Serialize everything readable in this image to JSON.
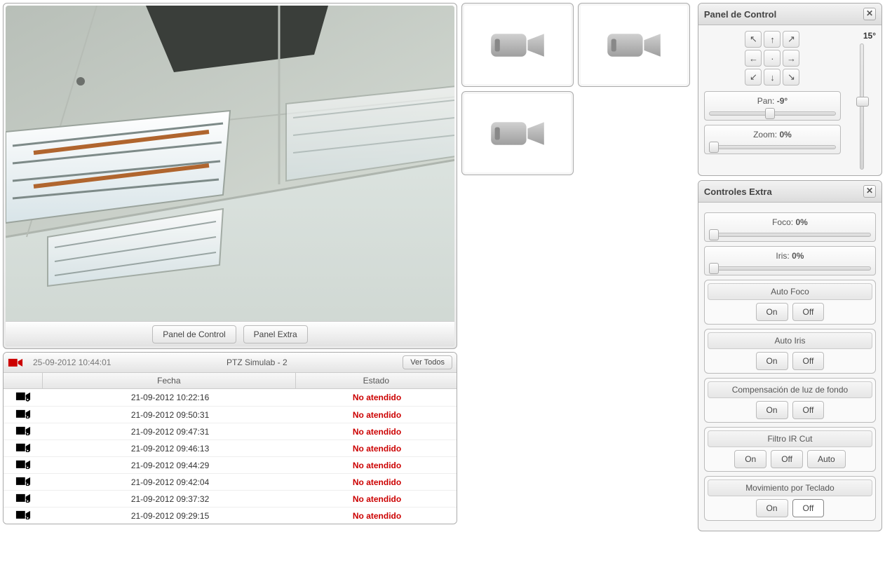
{
  "video": {
    "panel_control_btn": "Panel de Control",
    "panel_extra_btn": "Panel Extra"
  },
  "events": {
    "header_timestamp": "25-09-2012 10:44:01",
    "header_title": "PTZ Simulab - 2",
    "ver_todos_btn": "Ver Todos",
    "columns": {
      "fecha": "Fecha",
      "estado": "Estado"
    },
    "rows": [
      {
        "fecha": "21-09-2012 10:22:16",
        "estado": "No atendido"
      },
      {
        "fecha": "21-09-2012 09:50:31",
        "estado": "No atendido"
      },
      {
        "fecha": "21-09-2012 09:47:31",
        "estado": "No atendido"
      },
      {
        "fecha": "21-09-2012 09:46:13",
        "estado": "No atendido"
      },
      {
        "fecha": "21-09-2012 09:44:29",
        "estado": "No atendido"
      },
      {
        "fecha": "21-09-2012 09:42:04",
        "estado": "No atendido"
      },
      {
        "fecha": "21-09-2012 09:37:32",
        "estado": "No atendido"
      },
      {
        "fecha": "21-09-2012 09:29:15",
        "estado": "No atendido"
      }
    ]
  },
  "thumbnails": {
    "count": 3
  },
  "control_panel": {
    "title": "Panel de Control",
    "tilt_label": "15°",
    "pan_label": "Pan:",
    "pan_value": "-9°",
    "zoom_label": "Zoom:",
    "zoom_value": "0%"
  },
  "extra_controls": {
    "title": "Controles Extra",
    "foco_label": "Foco:",
    "foco_value": "0%",
    "iris_label": "Iris:",
    "iris_value": "0%",
    "auto_foco": "Auto Foco",
    "auto_iris": "Auto Iris",
    "backlight": "Compensación de luz de fondo",
    "ircut": "Filtro IR Cut",
    "keyboard": "Movimiento por Teclado",
    "on": "On",
    "off": "Off",
    "auto": "Auto"
  }
}
